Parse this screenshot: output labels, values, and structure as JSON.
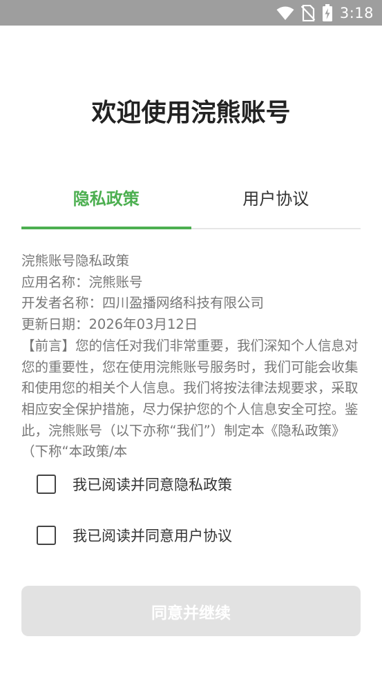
{
  "status_bar": {
    "time": "3:18",
    "icons": [
      "wifi-icon",
      "no-sim-icon",
      "battery-charging-icon"
    ]
  },
  "title": "欢迎使用浣熊账号",
  "tabs": [
    {
      "label": "隐私政策",
      "active": true
    },
    {
      "label": "用户协议",
      "active": false
    }
  ],
  "policy": {
    "lines": [
      "浣熊账号隐私政策",
      "应用名称：浣熊账号",
      "开发者名称：四川盈播网络科技有限公司",
      "更新日期：2026年03月12日"
    ],
    "body": "【前言】您的信任对我们非常重要，我们深知个人信息对您的重要性，您在使用浣熊账号服务时，我们可能会收集和使用您的相关个人信息。我们将按法律法规要求，采取相应安全保护措施，尽力保护您的个人信息安全可控。鉴此，浣熊账号（以下亦称“我们”）制定本《隐私政策》（下称“本政策/本"
  },
  "agreements": [
    {
      "label": "我已阅读并同意隐私政策",
      "checked": false
    },
    {
      "label": "我已阅读并同意用户协议",
      "checked": false
    }
  ],
  "continue_button": {
    "label": "同意并继续",
    "enabled": false
  },
  "colors": {
    "accent": "#4caf50",
    "status_bar": "#9e9e9e",
    "button_disabled": "#e2e2e2",
    "body_text": "#777777"
  }
}
